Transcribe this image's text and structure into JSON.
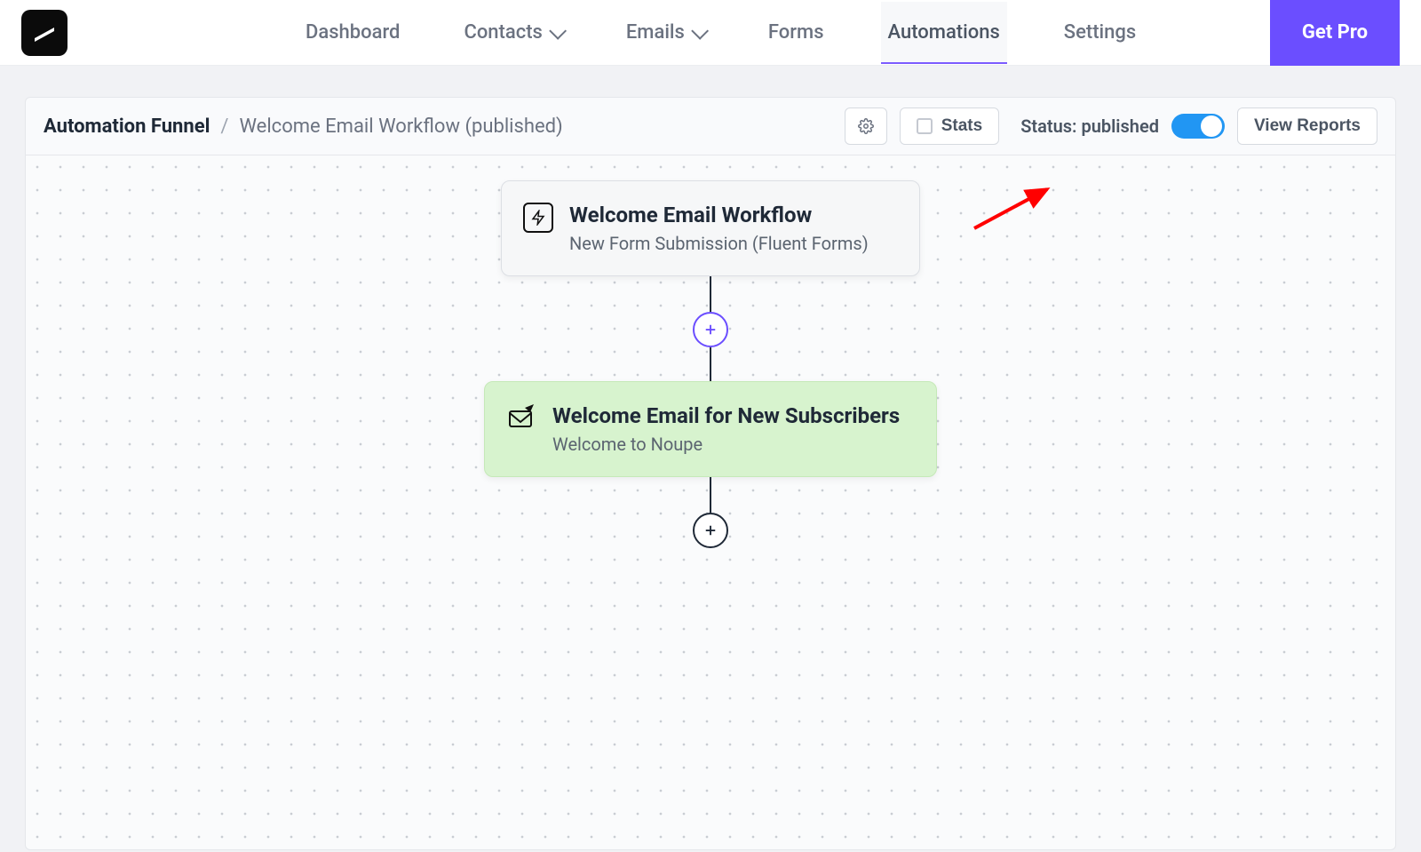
{
  "nav": {
    "items": [
      "Dashboard",
      "Contacts",
      "Emails",
      "Forms",
      "Automations",
      "Settings"
    ],
    "active_index": 4,
    "dropdown_indices": [
      1,
      2
    ],
    "get_pro_label": "Get Pro"
  },
  "toolbar": {
    "breadcrumb_root": "Automation Funnel",
    "breadcrumb_sep": "/",
    "breadcrumb_leaf": "Welcome Email Workflow (published)",
    "stats_label": "Stats",
    "status_text": "Status: published",
    "status_on": true,
    "view_reports_label": "View Reports"
  },
  "flow": {
    "trigger": {
      "title": "Welcome Email Workflow",
      "subtitle": "New Form Submission (Fluent Forms)"
    },
    "action": {
      "title": "Welcome Email for New Subscribers",
      "subtitle": "Welcome to Noupe"
    }
  },
  "colors": {
    "accent": "#6b4eff",
    "toggle_on": "#2196f3",
    "action_bg": "#d7f3ce",
    "annotation": "#ff0000"
  }
}
